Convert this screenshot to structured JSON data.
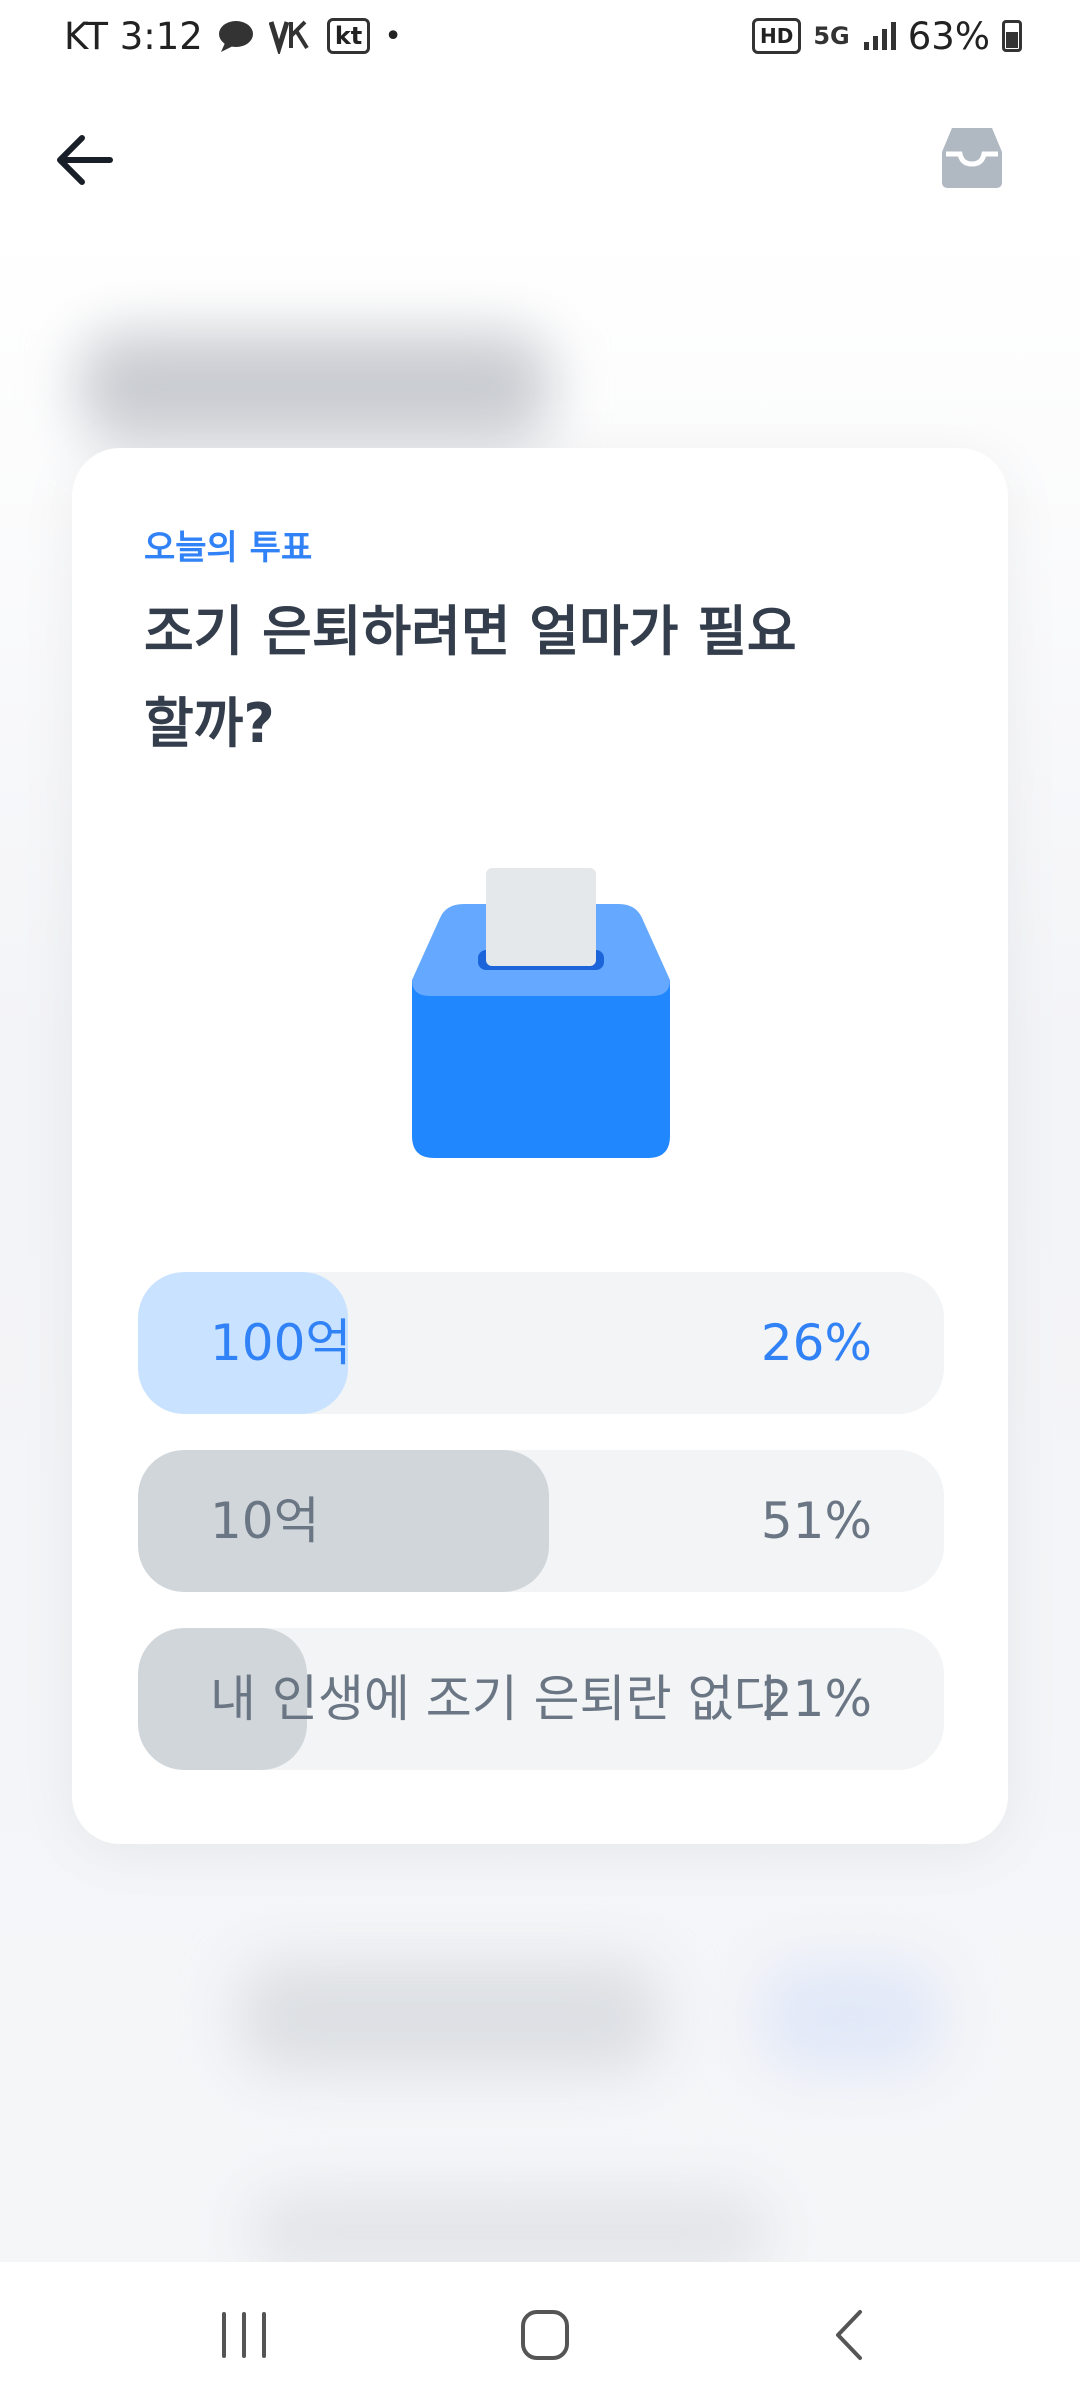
{
  "status_bar": {
    "carrier_time": "KT 3:12",
    "kt_badge": "kt",
    "dot": "•",
    "hd": "HD",
    "network": "5G",
    "battery": "63%",
    "icons": [
      "chat-bubble-icon",
      "volte-icon",
      "kt-icon",
      "hd-icon",
      "5g-icon",
      "signal-icon",
      "battery-icon"
    ]
  },
  "app_bar": {
    "back_icon": "arrow-left-icon",
    "inbox_icon": "inbox-tray-icon"
  },
  "poll": {
    "eyebrow": "오늘의 투표",
    "title": "조기 은퇴하려면 얼마가 필요할까?",
    "illustration": "ballot-box-icon",
    "options": [
      {
        "label": "100억",
        "percent": "26%",
        "value": 26,
        "selected": true
      },
      {
        "label": "10억",
        "percent": "51%",
        "value": 51,
        "selected": false
      },
      {
        "label": "내 인생에 조기 은퇴란 없다",
        "percent": "21%",
        "value": 21,
        "selected": false
      }
    ]
  },
  "colors": {
    "accent": "#3182f6",
    "selected_fill": "#c9e2ff",
    "other_fill": "#d1d6db",
    "track": "#f2f4f6",
    "title": "#333d4b",
    "option_text": "#6b7684"
  },
  "nav_bar": {
    "recents_icon": "recent-apps-icon",
    "home_icon": "home-icon",
    "back_icon": "back-chevron-icon"
  }
}
